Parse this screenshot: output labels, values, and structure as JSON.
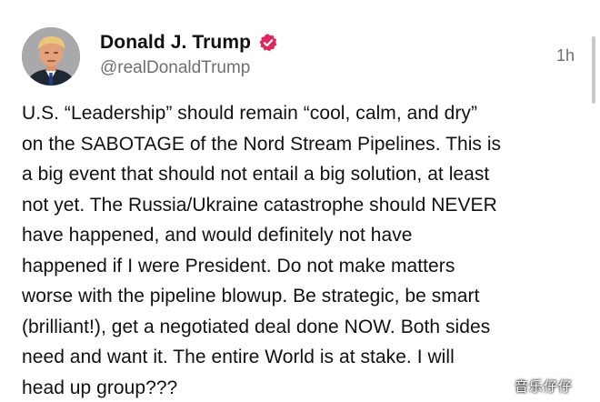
{
  "post": {
    "author": {
      "display_name": "Donald J. Trump",
      "handle": "@realDonaldTrump",
      "verified": true,
      "verified_badge_color": "#e0265c"
    },
    "timestamp": "1h",
    "body": "U.S. “Leadership” should remain “cool, calm, and dry”\non the SABOTAGE of the Nord Stream Pipelines. This is\na big event that should not entail a big solution, at least\nnot yet. The Russia/Ukraine catastrophe should NEVER\nhave happened, and would definitely not have\nhappened if I were President. Do not make matters\nworse with the pipeline blowup. Be strategic, be smart\n(brilliant!), get a negotiated deal done NOW. Both sides\nneed and want it. The entire World is at stake. I will\nhead up group???"
  },
  "watermark": "音乐仔仔",
  "icons": {
    "avatar": "profile-photo",
    "verified": "verified-check-badge-icon"
  },
  "colors": {
    "text_primary": "#111111",
    "text_secondary": "#6f6f73",
    "background": "#ffffff"
  }
}
